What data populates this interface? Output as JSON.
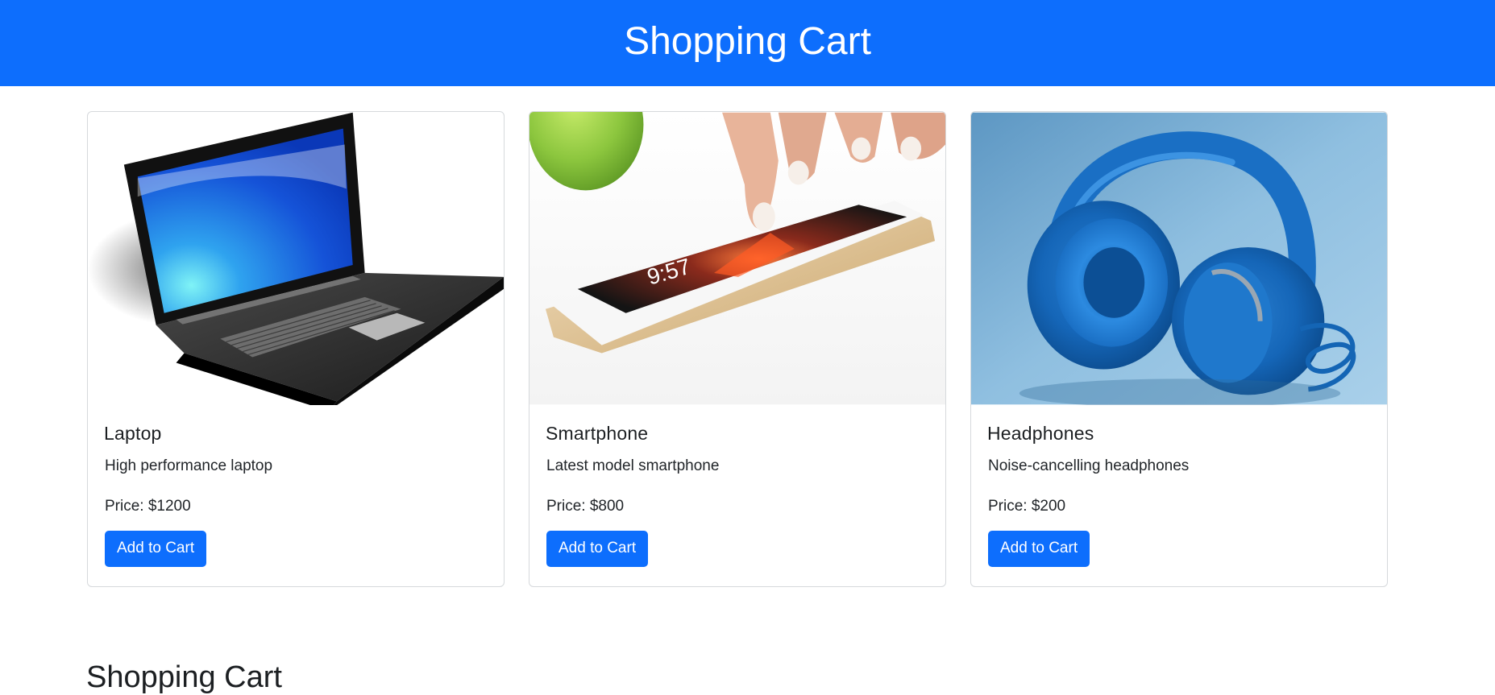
{
  "header": {
    "title": "Shopping Cart"
  },
  "products": [
    {
      "name": "Laptop",
      "description": "High performance laptop",
      "price": "Price: $1200",
      "button": "Add to Cart",
      "image": "laptop-image"
    },
    {
      "name": "Smartphone",
      "description": "Latest model smartphone",
      "price": "Price: $800",
      "button": "Add to Cart",
      "image": "smartphone-image"
    },
    {
      "name": "Headphones",
      "description": "Noise-cancelling headphones",
      "price": "Price: $200",
      "button": "Add to Cart",
      "image": "headphones-image"
    }
  ],
  "cart": {
    "heading": "Shopping Cart"
  },
  "colors": {
    "brand": "#0d6efd",
    "text": "#212529",
    "card_border": "#d6d9dc"
  }
}
